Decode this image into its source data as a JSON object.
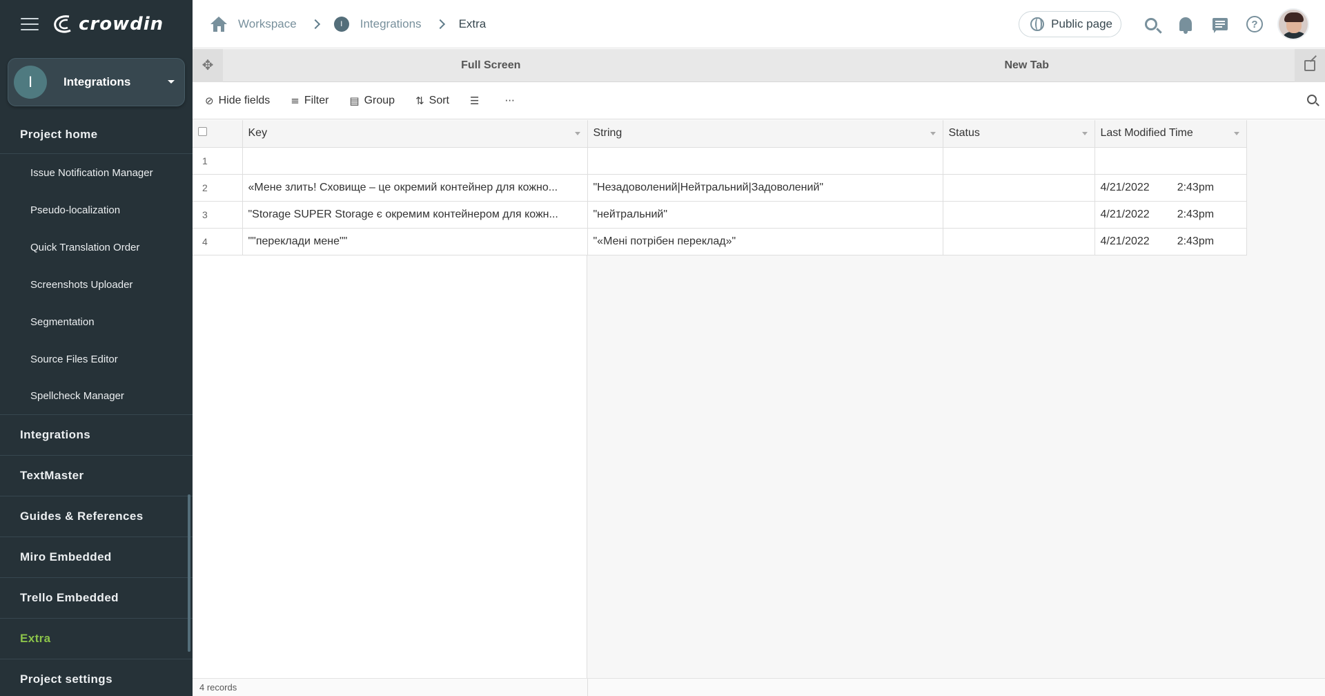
{
  "app": {
    "logo_text": "crowdin",
    "project": {
      "initial": "I",
      "name": "Integrations"
    }
  },
  "sidebar": {
    "project_home": "Project home",
    "sub_items": [
      "Issue Notification Manager",
      "Pseudo-localization",
      "Quick Translation Order",
      "Screenshots Uploader",
      "Segmentation",
      "Source Files Editor",
      "Spellcheck Manager"
    ],
    "items": [
      "Integrations",
      "TextMaster",
      "Guides & References",
      "Miro Embedded",
      "Trello Embedded",
      "Extra",
      "Project settings"
    ],
    "active_item": "Extra",
    "active_color": "#8bc34a"
  },
  "header": {
    "breadcrumb": {
      "workspace": "Workspace",
      "project_badge": "I",
      "project": "Integrations",
      "current": "Extra"
    },
    "public_page": "Public page"
  },
  "embed": {
    "tabs": [
      "Full Screen",
      "New Tab"
    ],
    "toolbar": {
      "hide_fields": "Hide fields",
      "filter": "Filter",
      "group": "Group",
      "sort": "Sort"
    },
    "table": {
      "columns": [
        "Key",
        "String",
        "Status",
        "Last Modified Time"
      ],
      "rows": [
        {
          "num": "1",
          "key": "",
          "string": "",
          "status": "",
          "date": "",
          "time": ""
        },
        {
          "num": "2",
          "key": "«Мене злить! Сховище – це окремий контейнер для кожно...",
          "string": "\"Незадоволений|Нейтральний|Задоволений\"",
          "status": "",
          "date": "4/21/2022",
          "time": "2:43pm"
        },
        {
          "num": "3",
          "key": "\"Storage SUPER Storage є окремим контейнером для кожн...",
          "string": "\"нейтральний\"",
          "status": "",
          "date": "4/21/2022",
          "time": "2:43pm"
        },
        {
          "num": "4",
          "key": "\"\"переклади мене\"\"",
          "string": "\"«Мені потрібен переклад»\"",
          "status": "",
          "date": "4/21/2022",
          "time": "2:43pm"
        }
      ]
    },
    "footer": {
      "records": "4 records"
    }
  }
}
